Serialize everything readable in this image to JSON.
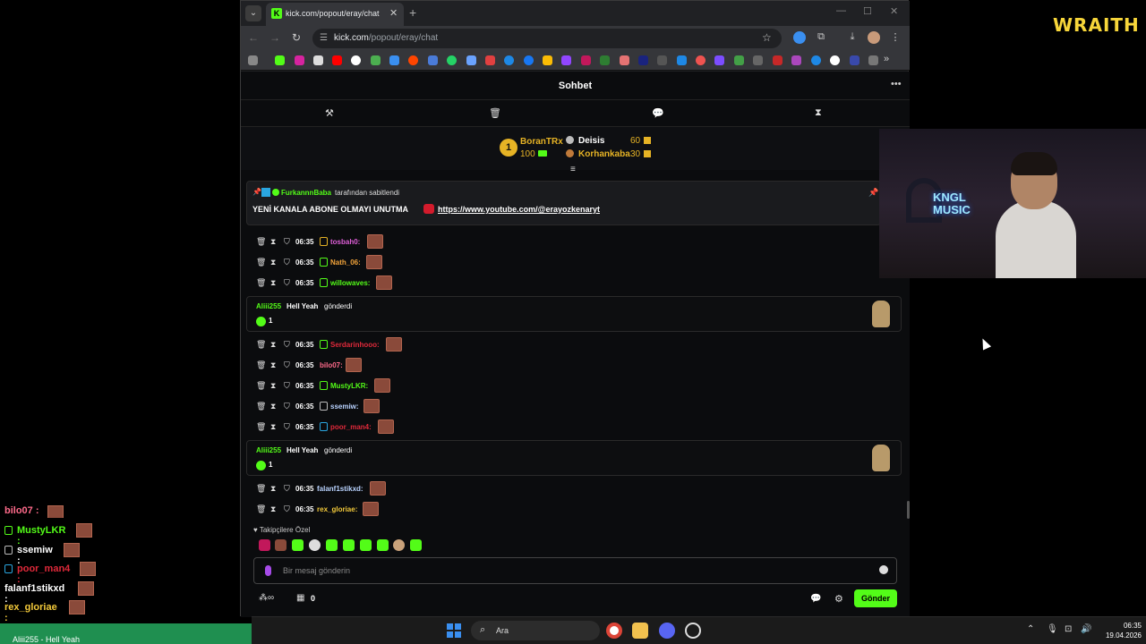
{
  "overlay_logo": "WRAITH",
  "browser": {
    "tab_title": "kick.com/popout/eray/chat",
    "url_domain": "kick.com",
    "url_path": "/popout/eray/chat"
  },
  "chat": {
    "title": "Sohbet",
    "leaderboard": {
      "rank": "1",
      "top_user": "BoranTRx",
      "top_value": "100",
      "second_user": "Deisis",
      "second_value": "60",
      "third_user": "Korhankaba",
      "third_value": "30"
    },
    "pinned": {
      "by_user": "FurkannnBaba",
      "by_suffix": "tarafından sabitlendi",
      "message": "YENİ KANALA ABONE OLMAYI UNUTMA",
      "link": "https://www.youtube.com/@erayozkenaryt"
    },
    "rows_top": [
      {
        "time": "06:35",
        "user": "tosbah0:",
        "color": "#e05fd9"
      },
      {
        "time": "06:35",
        "user": "Nath_06:",
        "color": "#f2a33a"
      },
      {
        "time": "06:35",
        "user": "willowaves:",
        "color": "#53fc18"
      }
    ],
    "gift1": {
      "user": "Aliii255",
      "item": "Hell Yeah",
      "verb": "gönderdi",
      "count": "1"
    },
    "rows_mid": [
      {
        "time": "06:35",
        "user": "Serdarinhooo:",
        "color": "#e0293a"
      },
      {
        "time": "06:35",
        "user": "bilo07:",
        "color": "#ff6b8b"
      },
      {
        "time": "06:35",
        "user": "MustyLKR:",
        "color": "#53fc18"
      },
      {
        "time": "06:35",
        "user": "ssemiw:",
        "color": "#b9d3ff"
      },
      {
        "time": "06:35",
        "user": "poor_man4:",
        "color": "#e0293a"
      }
    ],
    "gift2": {
      "user": "Aliii255",
      "item": "Hell Yeah",
      "verb": "gönderdi",
      "count": "1"
    },
    "rows_bottom": [
      {
        "time": "06:35",
        "user": "falanf1stikxd:",
        "color": "#b9d3ff"
      },
      {
        "time": "06:35",
        "user": "rex_gloriae:",
        "color": "#f2c93a"
      }
    ],
    "followers_label": "Takipçilere Özel",
    "input_placeholder": "Bir mesaj gönderin",
    "bottom_count": "0",
    "send_label": "Gönder"
  },
  "webcam": {
    "neon_line1": "KNGL",
    "neon_line2": "MUSIC"
  },
  "stream_overlay": {
    "rows": [
      {
        "user": "bilo07 :",
        "color": "#ff6b8b"
      },
      {
        "user": "MustyLKR :",
        "color": "#53fc18"
      },
      {
        "user": "ssemiw :",
        "color": "#ffffff"
      },
      {
        "user": "poor_man4 :",
        "color": "#e0293a"
      },
      {
        "user": "falanf1stikxd :",
        "color": "#ffffff"
      },
      {
        "user": "rex_gloriae :",
        "color": "#f2c93a"
      }
    ],
    "gift_notif": "Aliii255  - Hell Yeah"
  },
  "taskbar": {
    "search_text": "Ara",
    "time": "06:35",
    "date": "19.04.2026"
  },
  "colors": {
    "kick_green": "#53fc18",
    "gold": "#e6b325"
  }
}
